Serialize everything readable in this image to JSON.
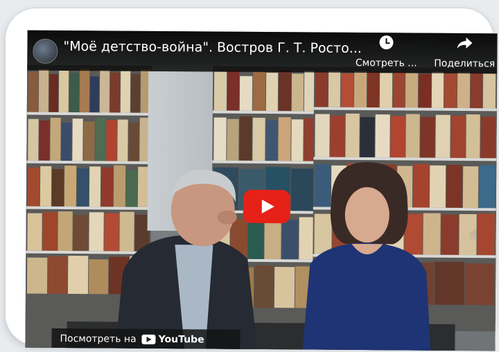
{
  "video": {
    "title": "\"Моё детство-война\". Востров Г. Т. Росто...",
    "channel_avatar_icon": "channel-avatar",
    "actions": {
      "watch_later_label": "Смотреть ...",
      "share_label": "Поделиться"
    },
    "watch_on_label": "Посмотреть на",
    "youtube_logo_text": "YouTube",
    "play_button_color": "#e62117"
  }
}
